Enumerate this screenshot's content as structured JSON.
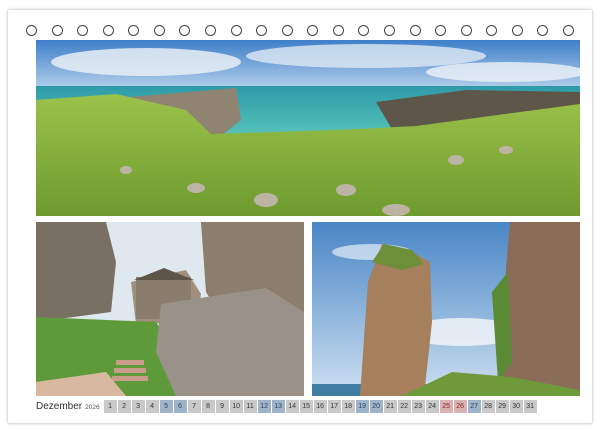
{
  "calendar": {
    "month": "Dezember",
    "year": "2026",
    "days": [
      "1",
      "2",
      "3",
      "4",
      "5",
      "6",
      "7",
      "8",
      "9",
      "10",
      "11",
      "12",
      "13",
      "14",
      "15",
      "16",
      "17",
      "18",
      "19",
      "20",
      "21",
      "22",
      "23",
      "24",
      "25",
      "26",
      "27",
      "28",
      "29",
      "30",
      "31"
    ],
    "weekend_days": [
      "5",
      "6",
      "12",
      "13",
      "19",
      "20",
      "26",
      "27"
    ],
    "holiday_days": [
      "25",
      "26"
    ]
  },
  "rings": {
    "count": 22
  },
  "colors": {
    "weekend": "#9fb4c9",
    "weekday": "#c9c9c9",
    "holiday": "#d9b3b3",
    "holiday_text": "#8b1e1e"
  },
  "photos": [
    {
      "name": "panorama-coastline"
    },
    {
      "name": "stone-chapel-in-cliffs"
    },
    {
      "name": "rock-stack-pillar"
    }
  ]
}
